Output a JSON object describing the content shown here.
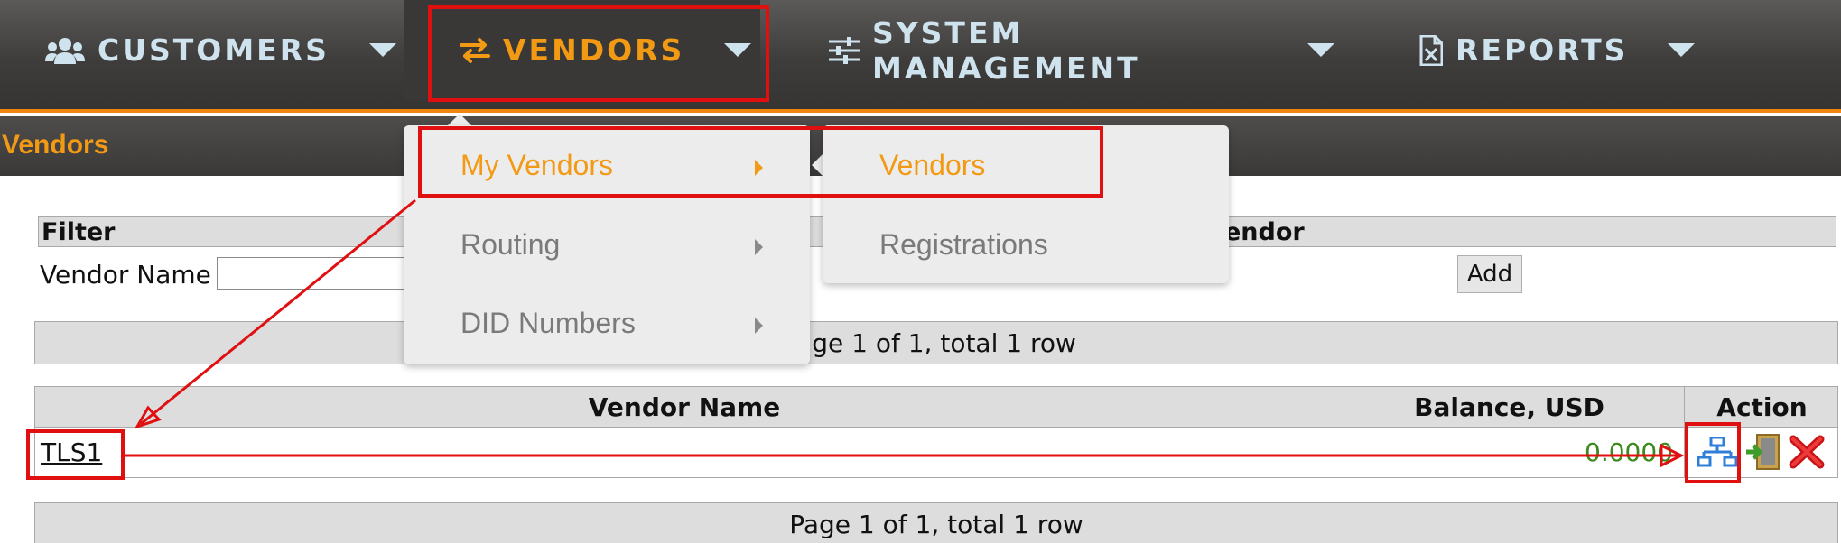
{
  "nav": {
    "items": [
      {
        "label": "CUSTOMERS",
        "icon": "users-icon"
      },
      {
        "label": "VENDORS",
        "icon": "swap-arrows-icon",
        "active": true
      },
      {
        "label": "SYSTEM MANAGEMENT",
        "icon": "sliders-icon"
      },
      {
        "label": "REPORTS",
        "icon": "excel-file-icon"
      }
    ],
    "active_color": "#f39a14",
    "text_color": "#cfe3ee"
  },
  "section": {
    "title": "Vendors"
  },
  "filter": {
    "header": "Filter",
    "vendor_name_label": "Vendor Name",
    "vendor_name_value": "",
    "vendor_header_suffix": "endor",
    "add_label": "Add"
  },
  "pager": {
    "top_text": "age 1 of 1, total 1 row",
    "bottom_text": "Page 1 of 1, total 1 row"
  },
  "table": {
    "columns": [
      "Vendor Name",
      "Balance, USD",
      "Action"
    ],
    "rows": [
      {
        "vendor_name": "TLS1",
        "balance": "0.0000",
        "actions": [
          "network-routing-icon",
          "exit-door-icon",
          "delete-x-icon"
        ]
      }
    ]
  },
  "dropdown": {
    "items": [
      {
        "label": "My Vendors",
        "active": true
      },
      {
        "label": "Routing"
      },
      {
        "label": "DID Numbers"
      }
    ],
    "submenu": [
      {
        "label": "Vendors",
        "active": true
      },
      {
        "label": "Registrations"
      }
    ]
  },
  "annotation_color": "#e01010"
}
